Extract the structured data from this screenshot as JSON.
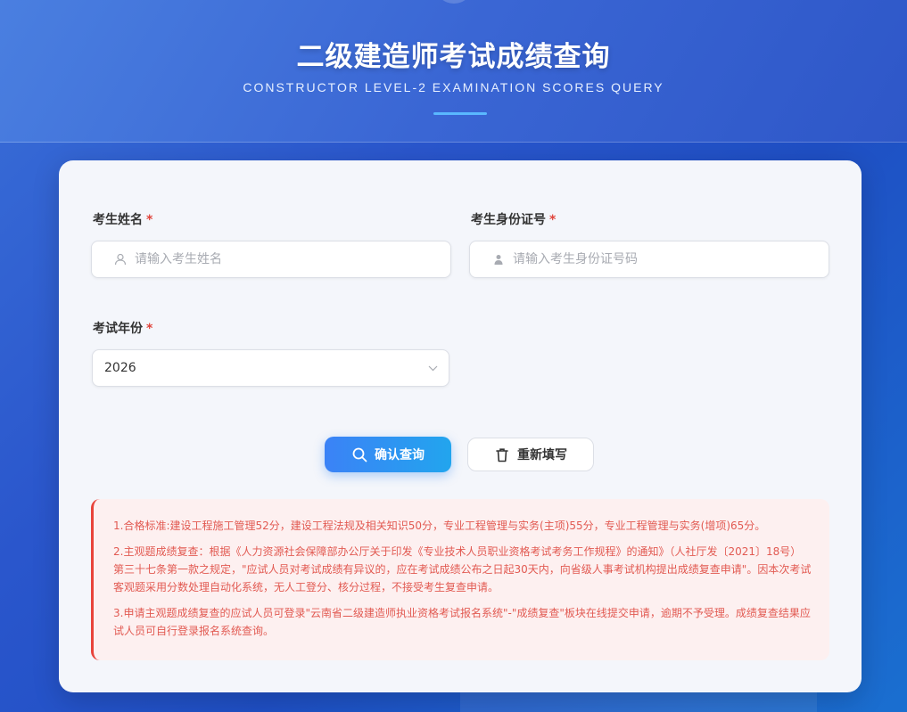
{
  "header": {
    "title": "二级建造师考试成绩查询",
    "subtitle": "CONSTRUCTOR LEVEL-2 EXAMINATION SCORES QUERY"
  },
  "form": {
    "name": {
      "label": "考生姓名",
      "required_mark": "*",
      "placeholder": "请输入考生姓名",
      "icon": "user-icon"
    },
    "id_number": {
      "label": "考生身份证号",
      "required_mark": "*",
      "placeholder": "请输入考生身份证号码",
      "icon": "person-icon"
    },
    "year": {
      "label": "考试年份",
      "required_mark": "*",
      "selected": "2026",
      "icon": "chevron-down-icon"
    }
  },
  "buttons": {
    "confirm_label": "确认查询",
    "confirm_icon": "search-icon",
    "reset_label": "重新填写",
    "reset_icon": "trash-icon"
  },
  "notice": {
    "items": [
      "1.合格标准:建设工程施工管理52分，建设工程法规及相关知识50分，专业工程管理与实务(主项)55分，专业工程管理与实务(增项)65分。",
      "2.主观题成绩复查：根据《人力资源社会保障部办公厅关于印发《专业技术人员职业资格考试考务工作规程》的通知》（人社厅发〔2021〕18号）第三十七条第一款之规定，\"应试人员对考试成绩有异议的，应在考试成绩公布之日起30天内，向省级人事考试机构提出成绩复查申请\"。因本次考试客观题采用分数处理自动化系统，无人工登分、核分过程，不接受考生复查申请。",
      "3.申请主观题成绩复查的应试人员可登录\"云南省二级建造师执业资格考试报名系统\"-\"成绩复查\"板块在线提交申请，逾期不予受理。成绩复查结果应试人员可自行登录报名系统查询。"
    ]
  },
  "colors": {
    "primary": "#3b82f6",
    "required": "#e0433a",
    "notice_text": "#e25a52",
    "notice_bg": "#fdf0f0"
  }
}
